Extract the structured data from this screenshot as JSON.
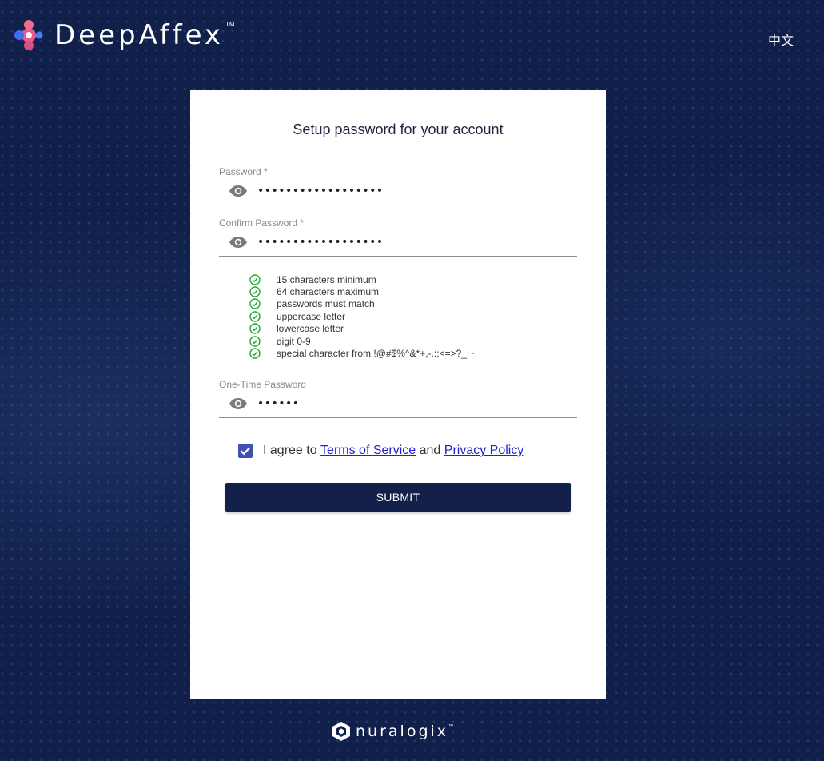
{
  "brand": {
    "name": "DeepAffex",
    "trademark": "TM"
  },
  "header": {
    "language_toggle": "中文"
  },
  "form": {
    "title": "Setup password for your account",
    "password": {
      "label": "Password *",
      "value": "••••••••••••••••••"
    },
    "confirm_password": {
      "label": "Confirm Password *",
      "value": "••••••••••••••••••"
    },
    "requirements": [
      "15 characters minimum",
      "64 characters maximum",
      "passwords must match",
      "uppercase letter",
      "lowercase letter",
      "digit 0-9",
      "special character from !@#$%^&*+,-.:;<=>?_|~"
    ],
    "otp": {
      "label": "One-Time Password",
      "value": "••••••"
    },
    "agree": {
      "prefix": "I agree to ",
      "terms": "Terms of Service",
      "middle": " and ",
      "privacy": "Privacy Policy",
      "checked": true
    },
    "submit_label": "SUBMIT"
  },
  "footer": {
    "brand": "nuralogix",
    "trademark": "™"
  },
  "colors": {
    "background": "#10204a",
    "button": "#13204a",
    "checkbox": "#3f51b5",
    "check_ok": "#22aa33",
    "link": "#2222cc"
  },
  "icons": {
    "visibility": "eye-icon",
    "requirement_ok": "check-circle-icon"
  }
}
